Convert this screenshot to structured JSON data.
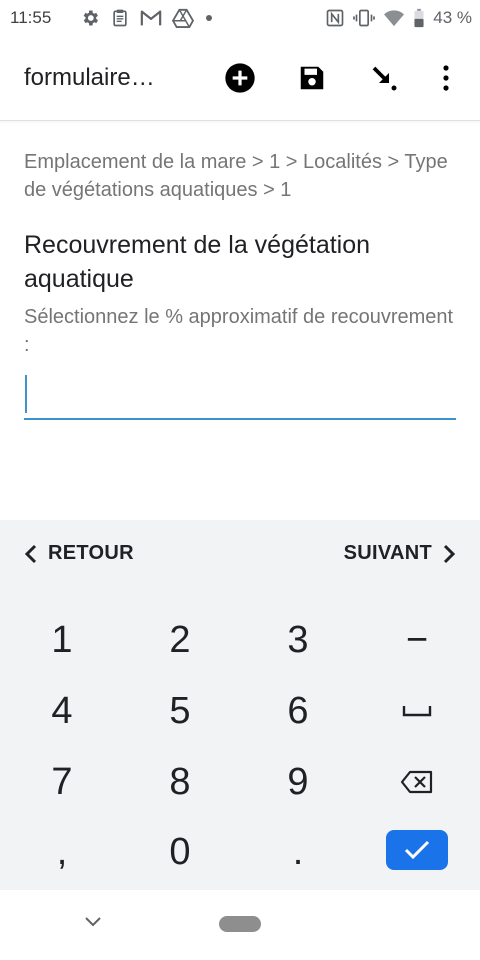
{
  "status_bar": {
    "time": "11:55",
    "battery": "43 %",
    "left_icons": [
      "settings-icon",
      "clipboard-icon",
      "gmail-icon",
      "drive-icon",
      "dot-icon"
    ],
    "right_icons": [
      "nfc-icon",
      "vibrate-icon",
      "wifi-icon",
      "battery-icon"
    ]
  },
  "app_bar": {
    "title": "formulaire…",
    "actions": [
      "add-icon",
      "save-icon",
      "jump-icon",
      "more-icon"
    ]
  },
  "content": {
    "breadcrumb": "Emplacement de la mare > 1 > Localités > Type de végétations aquatiques > 1",
    "question_title": "Recouvrement de la végétation aquatique",
    "question_hint": "Sélectionnez le % approximatif de recouvrement :",
    "answer_value": "",
    "answer_placeholder": ""
  },
  "navigation": {
    "back_label": "RETOUR",
    "next_label": "SUIVANT"
  },
  "keypad": {
    "keys": [
      "1",
      "2",
      "3",
      "−",
      "4",
      "5",
      "6",
      "␣",
      "7",
      "8",
      "9",
      "⌫",
      ",",
      "0",
      ".",
      "✓"
    ]
  },
  "colors": {
    "accent": "#3d93c9",
    "confirm": "#1a73e8",
    "keypad_bg": "#f1f3f4",
    "text_secondary": "#757575"
  }
}
